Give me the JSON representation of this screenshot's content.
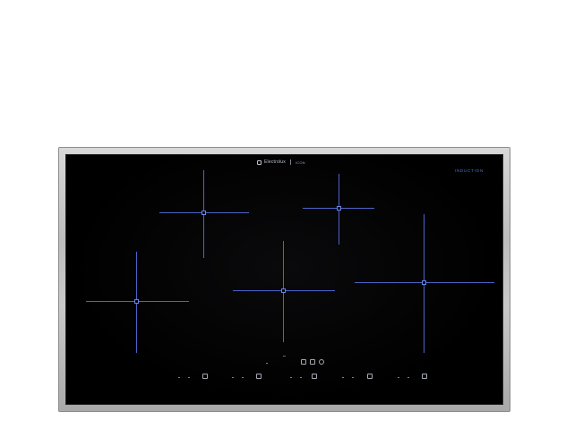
{
  "cooktop": {
    "brand": "Electrolux",
    "model_text": "ICON",
    "induction_label": "INDUCTION",
    "cooking_zones": 5,
    "zone_color": "#4c64c8",
    "glass_color": "#000000",
    "frame_color": "#c4c4c4"
  },
  "icons": {
    "brand_logo": "electrolux-logo-icon",
    "zone_marker": "square-marker-icon",
    "timer": "timer-icon",
    "lock": "lock-icon",
    "power": "power-icon",
    "zone_select": "zone-select-icon"
  }
}
